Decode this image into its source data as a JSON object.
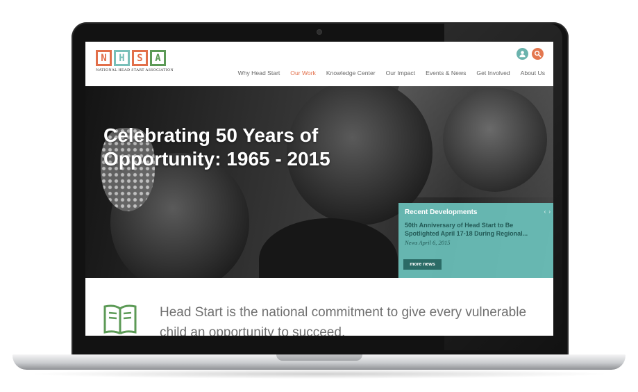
{
  "logo": {
    "letters": [
      "N",
      "H",
      "S",
      "A"
    ],
    "tagline": "NATIONAL HEAD START ASSOCIATION"
  },
  "header_icons": [
    "user-icon",
    "search-icon"
  ],
  "nav": {
    "items": [
      {
        "label": "Why Head Start",
        "active": false
      },
      {
        "label": "Our Work",
        "active": true
      },
      {
        "label": "Knowledge Center",
        "active": false
      },
      {
        "label": "Our Impact",
        "active": false
      },
      {
        "label": "Events & News",
        "active": false
      },
      {
        "label": "Get Involved",
        "active": false
      },
      {
        "label": "About Us",
        "active": false
      }
    ]
  },
  "hero": {
    "title": "Celebrating 50 Years of Opportunity: 1965 - 2015"
  },
  "recent_developments": {
    "title": "Recent Developments",
    "prev_icon": "‹",
    "next_icon": "›",
    "headline": "50th Anniversary of Head Start to Be Spotlighted April 17-18 During Regional...",
    "date": "News April 6, 2015",
    "button_label": "more news"
  },
  "intro": {
    "icon": "book-icon",
    "text": "Head Start is the national commitment to give every vulnerable child an opportunity to succeed."
  },
  "colors": {
    "orange": "#e26f4a",
    "teal": "#6bc1ba",
    "green": "#5c9a56",
    "nav_text": "#666666"
  }
}
